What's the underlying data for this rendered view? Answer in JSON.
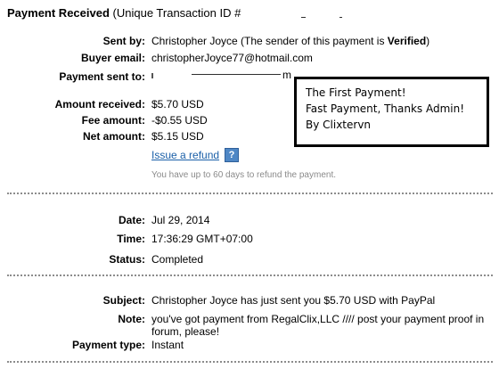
{
  "header": {
    "title_bold": "Payment Received",
    "title_rest": " (Unique Transaction ID #"
  },
  "sender": {
    "sent_by_label": "Sent by:",
    "sent_by_value": "Christopher Joyce (The sender of this payment is ",
    "verified": "Verified",
    "sent_by_tail": ")",
    "buyer_email_label": "Buyer email:",
    "buyer_email_value": "christopherJoyce77@hotmail.com",
    "payment_sent_to_label": "Payment sent to:",
    "payment_sent_to_suffix": "m"
  },
  "amounts": {
    "amount_received_label": "Amount received:",
    "amount_received_value": "$5.70 USD",
    "fee_label": "Fee amount:",
    "fee_value": "-$0.55 USD",
    "net_label": "Net amount:",
    "net_value": "$5.15 USD"
  },
  "refund": {
    "link_label": "Issue a refund",
    "help_icon_glyph": "?",
    "hint": "You have up to 60 days to refund the payment."
  },
  "note_box": {
    "line1": "The First Payment!",
    "line2": "Fast Payment, Thanks Admin!",
    "line3": "By Clixtervn"
  },
  "details": {
    "date_label": "Date:",
    "date_value": "Jul 29, 2014",
    "time_label": "Time:",
    "time_value": "17:36:29 GMT+07:00",
    "status_label": "Status:",
    "status_value": "Completed"
  },
  "message": {
    "subject_label": "Subject:",
    "subject_value": "Christopher Joyce has just sent you $5.70 USD with PayPal",
    "note_label": "Note:",
    "note_value": "you've got payment from RegalClix,LLC //// post your payment proof in forum, please!",
    "payment_type_label": "Payment type:",
    "payment_type_value": "Instant"
  },
  "colors": {
    "link": "#1a5fa8",
    "hint_text": "#8a8a8a",
    "divider": "#8c8c8c",
    "help_icon_bg": "#4f87c5"
  }
}
